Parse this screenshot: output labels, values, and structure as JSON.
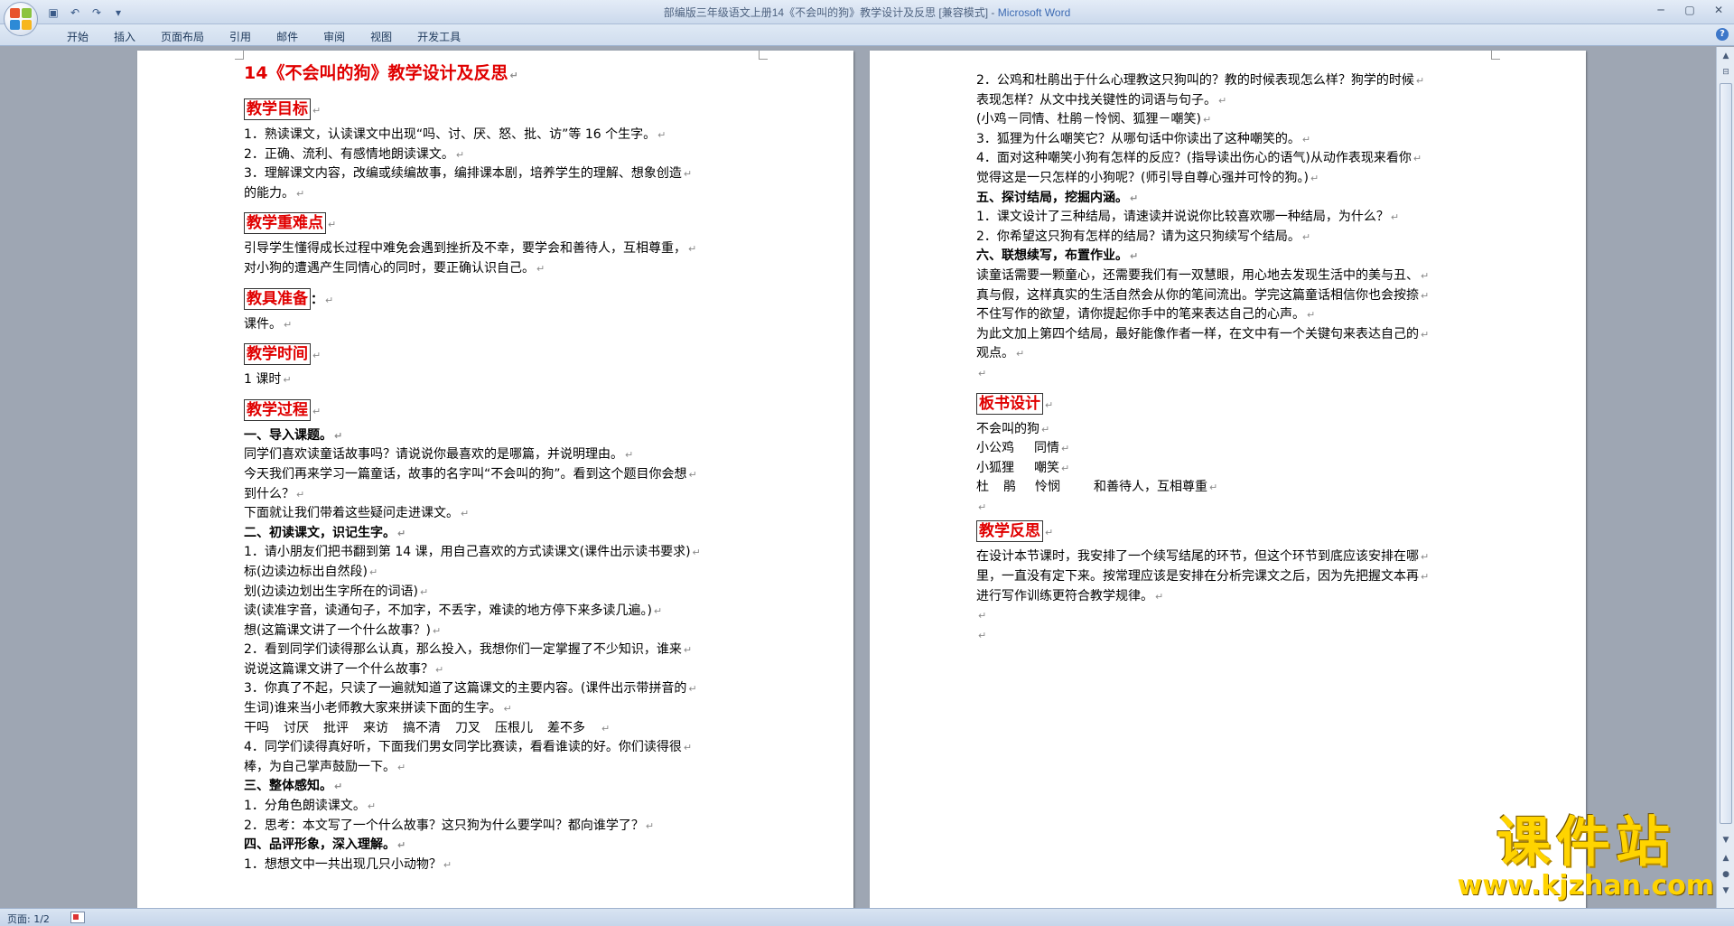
{
  "window": {
    "title": "部编版三年级语文上册14《不会叫的狗》教学设计及反思 [兼容模式] - ",
    "app_name": "Microsoft Word"
  },
  "ribbon": {
    "tabs": [
      "开始",
      "插入",
      "页面布局",
      "引用",
      "邮件",
      "审阅",
      "视图",
      "开发工具"
    ]
  },
  "status": {
    "page": "页面: 1/2"
  },
  "watermark": {
    "title": "课件站",
    "url": "www.kjzhan.com"
  },
  "colors": {
    "heading_red": "#e00000",
    "watermark_yellow": "#ffd400"
  },
  "icons": {
    "office_button": "office-logo-icon",
    "qat": [
      "save-icon",
      "undo-icon",
      "redo-icon",
      "customize-qat-icon"
    ],
    "window": [
      "minimize-icon",
      "maximize-icon",
      "close-icon"
    ]
  },
  "page1": {
    "title": "14《不会叫的狗》教学设计及反思",
    "sections": [
      {
        "heading": "教学目标",
        "lines": [
          "1．熟读课文，认读课文中出现“吗、讨、厌、怒、批、访”等 16 个生字。",
          "2．正确、流利、有感情地朗读课文。",
          "3．理解课文内容，改编或续编故事，编排课本剧，培养学生的理解、想象创造",
          "的能力。"
        ]
      },
      {
        "heading": "教学重难点",
        "lines": [
          "引导学生懂得成长过程中难免会遇到挫折及不幸，要学会和善待人，互相尊重，",
          "对小狗的遭遇产生同情心的同时，要正确认识自己。"
        ]
      },
      {
        "heading": "教具准备",
        "suffix": "：",
        "lines": [
          "课件。"
        ]
      },
      {
        "heading": "教学时间",
        "lines": [
          "1 课时"
        ]
      },
      {
        "heading": "教学过程",
        "lines": []
      }
    ],
    "process": [
      {
        "text": "一、导入课题。",
        "bold": true
      },
      {
        "text": "同学们喜欢读童话故事吗？请说说你最喜欢的是哪篇，并说明理由。"
      },
      {
        "text": "今天我们再来学习一篇童话，故事的名字叫“不会叫的狗”。看到这个题目你会想"
      },
      {
        "text": "到什么？"
      },
      {
        "text": "下面就让我们带着这些疑问走进课文。"
      },
      {
        "text": "二、初读课文，识记生字。",
        "bold": true
      },
      {
        "text": "1．请小朋友们把书翻到第 14 课，用自己喜欢的方式读课文(课件出示读书要求)"
      },
      {
        "text": "标(边读边标出自然段)"
      },
      {
        "text": "划(边读边划出生字所在的词语)"
      },
      {
        "text": "读(读准字音，读通句子，不加字，不丢字，难读的地方停下来多读几遍。)"
      },
      {
        "text": "想(这篇课文讲了一个什么故事？)"
      },
      {
        "text": "2．看到同学们读得那么认真，那么投入，我想你们一定掌握了不少知识，谁来"
      },
      {
        "text": "说说这篇课文讲了一个什么故事？"
      },
      {
        "text": "3．你真了不起，只读了一遍就知道了这篇课文的主要内容。(课件出示带拼音的"
      },
      {
        "text": "生词)谁来当小老师教大家来拼读下面的生字。"
      },
      {
        "vocab": [
          "干吗",
          "讨厌",
          "批评",
          "来访",
          "搞不清",
          "刀叉",
          "压根儿",
          "差不多"
        ]
      },
      {
        "text": "4．同学们读得真好听，下面我们男女同学比赛读，看看谁读的好。你们读得很"
      },
      {
        "text": "棒，为自己掌声鼓励一下。"
      },
      {
        "text": "三、整体感知。",
        "bold": true
      },
      {
        "text": "1．分角色朗读课文。"
      },
      {
        "text": "2．思考：本文写了一个什么故事？这只狗为什么要学叫？都向谁学了？"
      },
      {
        "text": "四、品评形象，深入理解。",
        "bold": true
      },
      {
        "text": "1．想想文中一共出现几只小动物？"
      }
    ]
  },
  "page2": {
    "lines": [
      {
        "text": "2．公鸡和杜鹃出于什么心理教这只狗叫的？教的时候表现怎么样？狗学的时候"
      },
      {
        "text": "表现怎样？从文中找关键性的词语与句子。"
      },
      {
        "text": "(小鸡－同情、杜鹃－怜悯、狐狸－嘲笑)"
      },
      {
        "text": "3．狐狸为什么嘲笑它？从哪句话中你读出了这种嘲笑的。"
      },
      {
        "text": "4．面对这种嘲笑小狗有怎样的反应？(指导读出伤心的语气)从动作表现来看你"
      },
      {
        "text": "觉得这是一只怎样的小狗呢？(师引导自尊心强并可怜的狗。)"
      },
      {
        "text": "五、探讨结局，挖掘内涵。",
        "bold": true
      },
      {
        "text": "1．课文设计了三种结局，请速读并说说你比较喜欢哪一种结局，为什么？"
      },
      {
        "text": "2．你希望这只狗有怎样的结局？请为这只狗续写个结局。"
      },
      {
        "text": "六、联想续写，布置作业。",
        "bold": true
      },
      {
        "text": "读童话需要一颗童心，还需要我们有一双慧眼，用心地去发现生活中的美与丑、"
      },
      {
        "text": "真与假，这样真实的生活自然会从你的笔间流出。学完这篇童话相信你也会按捺"
      },
      {
        "text": "不住写作的欲望，请你提起你手中的笔来表达自己的心声。"
      },
      {
        "text": "为此文加上第四个结局，最好能像作者一样，在文中有一个关键句来表达自己的"
      },
      {
        "text": "观点。"
      },
      {
        "text": ""
      }
    ],
    "board_heading": "板书设计",
    "board": [
      [
        "不会叫的狗"
      ],
      [
        "小公鸡",
        "同情"
      ],
      [
        "小狐狸",
        "嘲笑"
      ],
      [
        "杜",
        "鹃",
        "怜悯",
        "和善待人，互相尊重"
      ]
    ],
    "reflection_heading": "教学反思",
    "reflection": [
      "在设计本节课时，我安排了一个续写结尾的环节，但这个环节到底应该安排在哪",
      "里，一直没有定下来。按常理应该是安排在分析完课文之后，因为先把握文本再",
      "进行写作训练更符合教学规律。"
    ]
  }
}
